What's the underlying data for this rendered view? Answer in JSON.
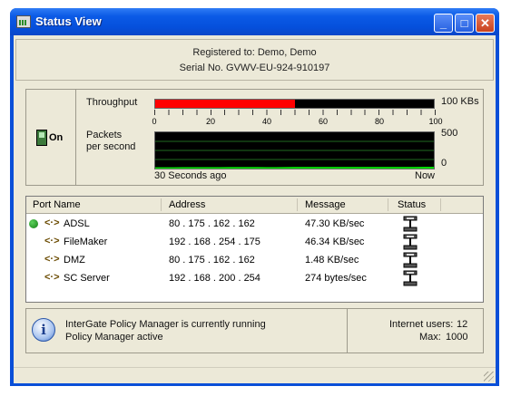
{
  "window": {
    "title": "Status View",
    "minimize": "_",
    "maximize": "□",
    "close": "✕"
  },
  "registration": {
    "line1": "Registered to: Demo, Demo",
    "line2": "Serial No. GVWV-EU-924-910197"
  },
  "stats": {
    "toggle_label": "On",
    "throughput_label": "Throughput",
    "throughput_max": "100 KBs",
    "throughput_fraction": 0.5,
    "scale_ticks": [
      "0",
      "20",
      "40",
      "60",
      "80",
      "100"
    ],
    "packets_label_1": "Packets",
    "packets_label_2": "per second",
    "packets_max": "500",
    "packets_min": "0",
    "time_start": "30 Seconds ago",
    "time_end": "Now",
    "packets_history": [
      18,
      18,
      18,
      19,
      19,
      19,
      19,
      19,
      20,
      20,
      20,
      20,
      19,
      19,
      20,
      22,
      21,
      21,
      21,
      22,
      23,
      22,
      21,
      22,
      22,
      23,
      22,
      22,
      23,
      24,
      24
    ]
  },
  "ports": {
    "headers": {
      "name": "Port Name",
      "address": "Address",
      "message": "Message",
      "status": "Status"
    },
    "rows": [
      {
        "name": "ADSL",
        "address": "80 . 175 . 162 . 162",
        "message": "47.30 KB/sec",
        "active": true
      },
      {
        "name": "FileMaker",
        "address": "192 . 168 . 254 . 175",
        "message": "46.34 KB/sec",
        "active": false
      },
      {
        "name": "DMZ",
        "address": "80 . 175 . 162 . 162",
        "message": "1.48 KB/sec",
        "active": false
      },
      {
        "name": "SC Server",
        "address": "192 . 168 . 200 . 254",
        "message": "274 bytes/sec",
        "active": false
      }
    ]
  },
  "footer": {
    "status_line1": "InterGate Policy Manager is currently running",
    "status_line2": "Policy Manager active",
    "users_label": "Internet users:",
    "users_value": "12",
    "max_label": "Max:",
    "max_value": "1000"
  }
}
